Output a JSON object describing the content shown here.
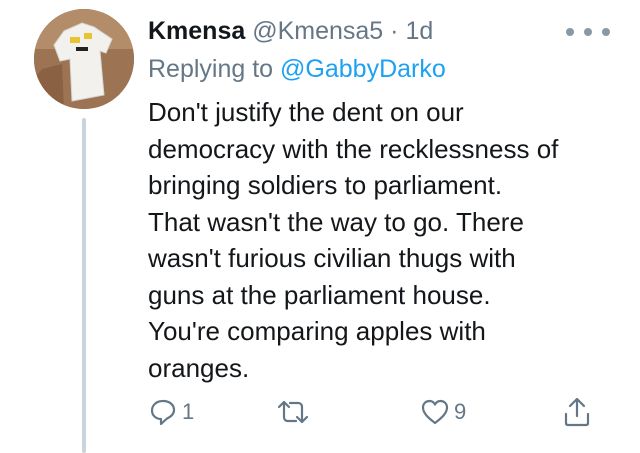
{
  "tweet": {
    "author_name": "Kmensa",
    "author_handle": "@Kmensa5",
    "separator": "·",
    "time": "1d",
    "replying_prefix": "Replying to",
    "replying_to": "@GabbyDarko",
    "text_lines": [
      "Don't justify the dent on our",
      "democracy with the recklessness of",
      "bringing soldiers to parliament.",
      "That wasn't the way to go. There",
      "wasn't furious civilian thugs with",
      "guns at the parliament house.",
      "You're comparing apples with",
      "oranges."
    ],
    "reply_count": "1",
    "retweet_count": "",
    "like_count": "9"
  },
  "icons": {
    "avatar": "avatar-image",
    "more": "more-icon",
    "reply": "reply-icon",
    "retweet": "retweet-icon",
    "like": "heart-icon",
    "share": "share-icon"
  },
  "colors": {
    "text": "#14171a",
    "secondary": "#657786",
    "link": "#1da1f2",
    "thread_line": "#c9d4dc"
  }
}
